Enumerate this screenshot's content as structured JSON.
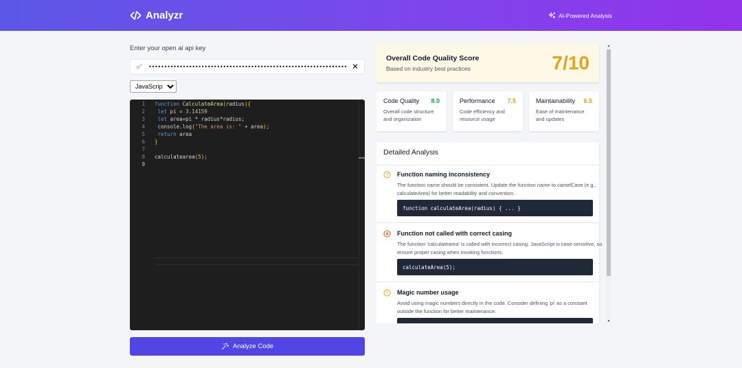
{
  "header": {
    "brand": "Analyzr",
    "badge": "AI-Powered Analysis",
    "brand_icon": "code-icon",
    "badge_icon": "sparkles-icon"
  },
  "api": {
    "label": "Enter your open ai api key",
    "value": "••••••••••••••••••••••••••••••••••••••••••••••••••••••••••••••••••••••••••••••••••••••••••",
    "clear": "✕"
  },
  "language": {
    "selected": "JavaScript"
  },
  "editor": {
    "line_numbers": [
      "1",
      "2",
      "3",
      "4",
      "5",
      "6",
      "7",
      "8",
      "9"
    ]
  },
  "analyze_button": "Analyze Code",
  "score": {
    "title": "Overall Code Quality Score",
    "subtitle": "Based on industry best practices",
    "value": "7/10",
    "color": "#e5a21a"
  },
  "metrics": [
    {
      "name": "Code Quality",
      "value": "8.0",
      "color": "#16a34a",
      "desc": "Overall code structure and organization"
    },
    {
      "name": "Performance",
      "value": "7.5",
      "color": "#e5a21a",
      "desc": "Code efficiency and resource usage"
    },
    {
      "name": "Maintainability",
      "value": "6.5",
      "color": "#e5a21a",
      "desc": "Ease of maintenance and updates"
    }
  ],
  "analysis": {
    "title": "Detailed Analysis",
    "issues": [
      {
        "title": "Function naming inconsistency",
        "desc": "The function name should be consistent. Update the function name to camelCase (e.g., calculateArea) for better readability and convention.",
        "code": "function calculateArea(radius) { ... }",
        "icon": "warning-circle-icon",
        "color": "#e5a21a"
      },
      {
        "title": "Function not called with correct casing",
        "desc": "The function 'calculatearea' is called with incorrect casing. JavaScript is case-sensitive, so ensure proper casing when invoking functions.",
        "code": "calculateArea(5);",
        "icon": "error-circle-icon",
        "color": "#ea580c"
      },
      {
        "title": "Magic number usage",
        "desc": "Avoid using magic numbers directly in the code. Consider defining 'pi' as a constant outside the function for better maintenance.",
        "code": "",
        "icon": "warning-circle-icon",
        "color": "#e5a21a"
      }
    ]
  },
  "colors": {
    "header_start": "#5b57e6",
    "header_end": "#9333ea",
    "primary_button": "#4f46e5",
    "editor_bg": "#1e1e1e"
  }
}
